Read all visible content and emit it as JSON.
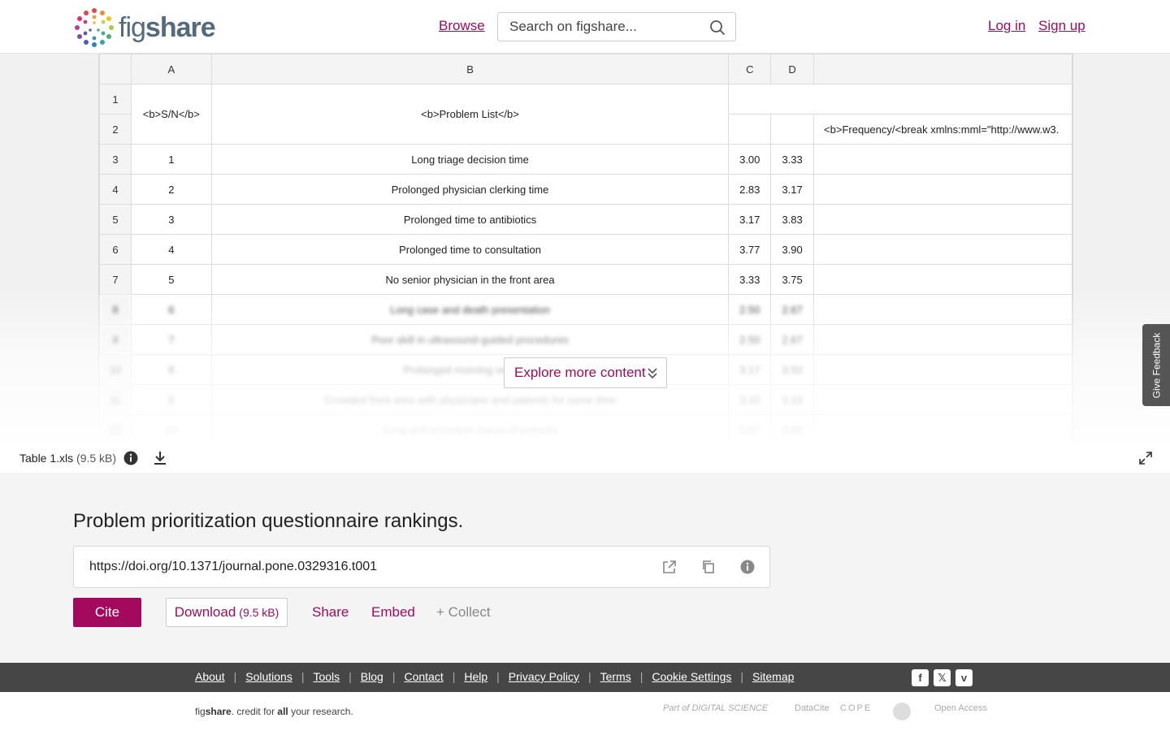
{
  "header": {
    "logo_text_a": "fig",
    "logo_text_b": "share",
    "browse": "Browse",
    "search_placeholder": "Search on figshare...",
    "login": "Log in",
    "signup": "Sign up"
  },
  "sheet": {
    "columns": [
      "A",
      "B",
      "C",
      "D"
    ],
    "header_a": "<b>S/N</b>",
    "header_b": "<b>Problem List</b>",
    "freq_header": "<b>Frequency/<break xmlns:mml=\"http://www.w3.",
    "rows": [
      {
        "n": "3",
        "sn": "1",
        "problem": "Long triage decision time",
        "c": "3.00",
        "d": "3.33"
      },
      {
        "n": "4",
        "sn": "2",
        "problem": "Prolonged physician clerking time",
        "c": "2.83",
        "d": "3.17"
      },
      {
        "n": "5",
        "sn": "3",
        "problem": "Prolonged time to antibiotics",
        "c": "3.17",
        "d": "3.83"
      },
      {
        "n": "6",
        "sn": "4",
        "problem": "Prolonged time to consultation",
        "c": "3.77",
        "d": "3.90"
      },
      {
        "n": "7",
        "sn": "5",
        "problem": "No senior physician in the front area",
        "c": "3.33",
        "d": "3.75"
      },
      {
        "n": "8",
        "sn": "6",
        "problem": "Long case and death presentation",
        "c": "2.50",
        "d": "2.67"
      },
      {
        "n": "9",
        "sn": "7",
        "problem": "Poor skill in ultrasound-guided procedures",
        "c": "2.50",
        "d": "2.67"
      },
      {
        "n": "10",
        "sn": "8",
        "problem": "Prolonged morning sessions",
        "c": "3.17",
        "d": "3.50"
      },
      {
        "n": "11",
        "sn": "9",
        "problem": "Crowded front area with physicians and patients for some time",
        "c": "3.33",
        "d": "3.33"
      },
      {
        "n": "12",
        "sn": "10",
        "problem": "Long and uncertain transit of patients",
        "c": "2.67",
        "d": "3.00"
      }
    ],
    "explore": "Explore more content",
    "feedback": "Give Feedback"
  },
  "file": {
    "name": "Table 1.xls",
    "size": "(9.5 kB)"
  },
  "item": {
    "title": "Problem prioritization questionnaire rankings.",
    "doi": "https://doi.org/10.1371/journal.pone.0329316.t001",
    "cite": "Cite",
    "download": "Download",
    "download_size": "(9.5 kB)",
    "share": "Share",
    "embed": "Embed",
    "collect": "+ Collect"
  },
  "footer": {
    "links": [
      "About",
      "Solutions",
      "Tools",
      "Blog",
      "Contact",
      "Help",
      "Privacy Policy",
      "Terms",
      "Cookie Settings",
      "Sitemap"
    ],
    "tagline_fig": "fig",
    "tagline_share": "share",
    "tagline_a": ". credit for ",
    "tagline_all": "all",
    "tagline_b": " your research.",
    "partners": [
      "Part of DIGITAL SCIENCE",
      "DataCite",
      "COPE",
      "Open Access"
    ]
  },
  "colors": {
    "brand": "#a3095d",
    "footer_bg": "#464646"
  }
}
